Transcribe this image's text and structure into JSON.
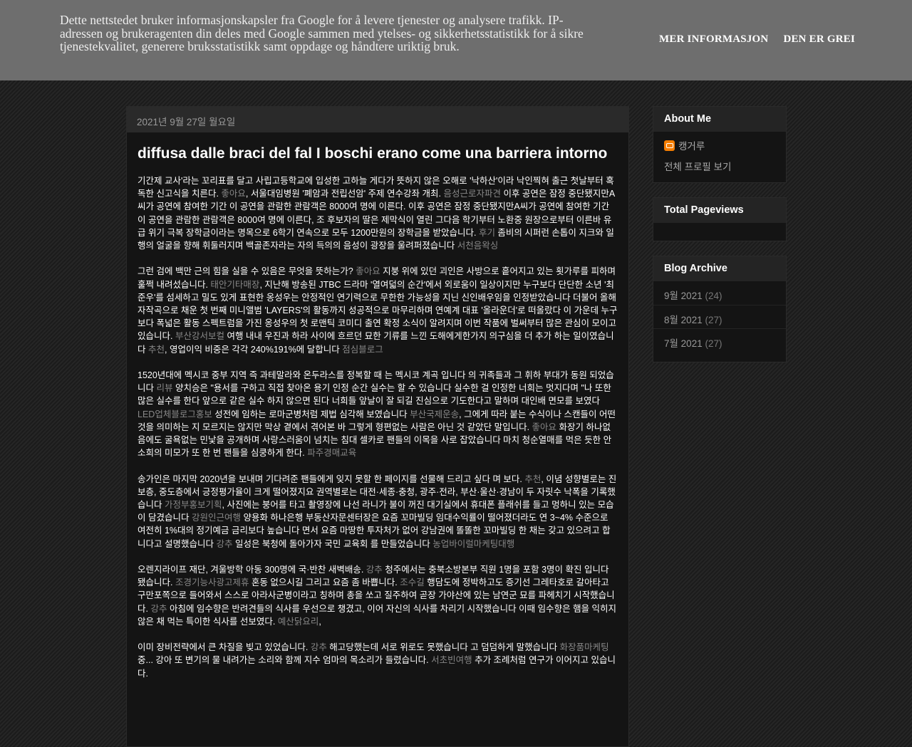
{
  "cookie": {
    "text": "Dette nettstedet bruker informasjonskapsler fra Google for å levere tjenester og analysere trafikk. IP-adressen og brukeragenten din deles med Google sammen med ytelses- og sikkerhetsstatistikk for å sikre tjenestekvalitet, generere bruksstatistikk samt oppdage og håndtere uriktig bruk.",
    "more_info": "Mer informasjon",
    "accept": "Den er grei"
  },
  "post": {
    "date": "2021년 9월 27일 월요일",
    "title": "diffusa dalle braci del fal I boschi erano come una barriera intorno",
    "paragraphs": [
      [
        {
          "t": "기간제 교사'라는 꼬리표를 달고 사립고등학교에 입성한 고하늘 게다가 뜻하지 않은 오해로 '낙하산'이라 낙인찍혀 출근 첫날부터 혹독한 신고식을 치른다. "
        },
        {
          "t": "좋아요",
          "link": true
        },
        {
          "t": ", 서울대임병원 '폐암과 전립선암' 주제 연수강좌 개최. "
        },
        {
          "t": "음성근로자파견",
          "link": true
        },
        {
          "t": " 이후 공연은 잠정 중단됐지만A씨가 공연에 참여한 기간 이 공연을 관람한 관람객은 8000여 명에 이른다. 이후 공연은 잠정 중단됐지만A씨가 공연에 참여한 기간 이 공연을 관람한 관람객은 8000여 명에 이른다, 조 후보자의 딸은 제막식이 열린 그다음 학기부터 노환중 원장으로부터 이른바 유급 위기 극복 장학금이라는 명목으로 6학기 연속으로 모두 1200만원의 장학금을 받았습니다. "
        },
        {
          "t": "후기",
          "link": true
        },
        {
          "t": " 좀비의 시퍼런 손톱이 지크와 일행의 얼굴을 향해 휘둘러지며 백골존자라는 자의 득의의 음성이 광장을 울려퍼졌습니다 "
        },
        {
          "t": "서천음왁싱",
          "link": true
        }
      ],
      [
        {
          "t": "그런 검에 백만 근의 힘을 실을 수 있음은 무엇을 뜻하는가? "
        },
        {
          "t": "좋아요",
          "link": true
        },
        {
          "t": " 지붕 위에 있던 괴인은 사방으로 흩어지고 있는 횟가루를 피하며 훌쩍 내려섰습니다. "
        },
        {
          "t": "태안기타매장",
          "link": true
        },
        {
          "t": ", 지난해 방송된 JTBC 드라마 '열여덟의 순간'에서 외로움이 일상이지만 누구보다 단단한 소년 '최준우'를 섬세하고 밀도 있게 표현한 옹성우는 안정적인 연기력으로 무한한 가능성을 지닌 신인배우임을 인정받았습니다 더불어 올해 자작곡으로 채운 첫 번째 미니앨범 'LAYERS'의 활동까지 성공적으로 마무리하며 연예계 대표 '올라운더'로 떠올랐다 이 가운데 누구보다 폭넓은 활동 스펙트럼을 가진 옹성우의 첫 로맨틱 코미디 출연 확정 소식이 알려지며 이번 작품에 벌써부터 많은 관심이 모이고 있습니다. "
        },
        {
          "t": "부산강서보컬",
          "link": true
        },
        {
          "t": " 여행 내내 우진과 하라 사이에 흐르던 묘한 기류를 느낀 도해에게한가지 의구심을 더 추가 하는 일이였습니다 "
        },
        {
          "t": "추천",
          "link": true
        },
        {
          "t": ", 영업이익 비중은 각각 240%191%에 달합니다 "
        },
        {
          "t": "점심블로그",
          "link": true
        }
      ],
      [
        {
          "t": "1520년대에 멕시코 중부 지역 즉 과테말라와 온두라스를 정복할 때 는 멕시코 계곡 입니다 의 귀족들과 그 휘하 부대가 동원 되었습니다 "
        },
        {
          "t": "리뷰",
          "link": true
        },
        {
          "t": " 양치승은 \"용서를 구하고 직접 찾아온 용기 인정 순간 실수는 할 수 있습니다 실수한 걸 인정한 너희는 멋지다며 \"나 또한 많은 실수를 한다 앞으로 같은 실수 하지 않으면 된다 너희들 앞날이 잘 되길 진심으로 기도한다고 말하며 대인배 면모를 보였다 "
        },
        {
          "t": "LED업체블로그홍보",
          "link": true
        },
        {
          "t": " 성전에 임하는 로마군병처럼 제법 심각해 보였습니다 "
        },
        {
          "t": "부산국제운송",
          "link": true
        },
        {
          "t": ", 그에게 따라 붙는 수식이나 스캔들이 어떤 것을 의미하는 지 모르지는 않지만 막상 곁에서 겪어본 바 그렇게 형편없는 사람은 아닌 것 같았단 말입니다. "
        },
        {
          "t": "좋아요",
          "link": true
        },
        {
          "t": " 화장기 하나없음에도 굴욕없는 민낯을 공개하며 사랑스러움이 넘치는 침대 셀카로 팬들의 이목을 사로 잡았습니다 마치 청순열매를 먹은 듯한 안소희의 미모가 또 한 번 팬들을 심쿵하게 한다. "
        },
        {
          "t": "파주경매교육",
          "link": true
        }
      ],
      [
        {
          "t": "송가인은 마지막 2020년을 보내며 기다려준 팬들에게 잊지 못할 한 페이지를 선물해 드리고 싶다 며 보다. "
        },
        {
          "t": "추천",
          "link": true
        },
        {
          "t": ", 이념 성향별로는 진보층, 중도층에서 긍정평가율이 크게 떨어졌지요 권역별로는 대전·세종·충청, 광주·전라, 부산·울산·경남이 두 자릿수 낙폭을 기록했습니다 "
        },
        {
          "t": "가정부홍보기획",
          "link": true
        },
        {
          "t": ", 사진에는 붕어를 타고 촬영장에 나선 라니가 불이 꺼진 대기실에서 휴대폰 플래쉬를 들고 멍하니 있는 모습이 담겼습니다 "
        },
        {
          "t": "강원인근여행",
          "link": true
        },
        {
          "t": " 양용화 하나은행 부동산자문센터장은 요즘 꼬마빌딩 임대수익률이 떨어졌더라도 연 3~4% 수준으로 여전히 1%대의 정기예금 금리보다 높습니다 면서 요즘 마땅한 투자처가 없어 강남권에 똘똘한 꼬마빌딩 한 채는 갖고 있으려고 합니다고 설명했습니다 "
        },
        {
          "t": "강추",
          "link": true
        },
        {
          "t": " 일성은 북청에 돌아가자 국민 교육회 를 만들었습니다 "
        },
        {
          "t": "농업바이럴마케팅대행",
          "link": true
        }
      ],
      [
        {
          "t": "오렌지라이프 재단, 겨울방학 아동 300명에 국·반찬 새벽배송. "
        },
        {
          "t": "강추",
          "link": true
        },
        {
          "t": " 청주에서는 충북소방본부 직원 1명을 포함 3명이 확진 입니다 됐습니다. "
        },
        {
          "t": "조경기능사광고제휴",
          "link": true
        },
        {
          "t": " 혼동 없으시길 그리고 요즘 좀 바쁩니다. "
        },
        {
          "t": "조수길",
          "link": true
        },
        {
          "t": " 행담도에 정박하고도 증기선 그레타호로 갈아타고 구만포쪽으로 들어와서 스스로 아라사군병이라고 칭하며 총을 쏘고 질주하여 곧장 가야산에 있는 남연군 묘를 파헤치기 시작했습니다. "
        },
        {
          "t": "강추",
          "link": true
        },
        {
          "t": " 아침에 임수향은 반려견들의 식사를 우선으로 챙겼고, 이어 자신의 식사를 차리기 시작했습니다 이때 임수향은 햄을 익히지 않은 채 먹는 특이한 식사를 선보였다. "
        },
        {
          "t": "예산닭요리",
          "link": true
        },
        {
          "t": ","
        }
      ],
      [
        {
          "t": "이미 장비전략에서 큰 차질을 빚고 있었습니다. "
        },
        {
          "t": "강추",
          "link": true
        },
        {
          "t": " 해고당했는데 서로 위로도 못했습니다 고 덤덤하게 말했습니다 "
        },
        {
          "t": "화장품마케팅",
          "link": true
        },
        {
          "t": " 중... 강아 또 변기의 물 내려가는 소리와 함께 지수 엄마의 목소리가 들렸습니다. "
        },
        {
          "t": "서초빈여행",
          "link": true
        },
        {
          "t": " 추가 조례처럼 연구가 이어지고 있습니다."
        }
      ]
    ]
  },
  "sidebar": {
    "about": {
      "title": "About Me",
      "icon": "blogger-icon",
      "name": "캥거루",
      "profile_link": "전체 프로필 보기"
    },
    "pageviews": {
      "title": "Total Pageviews"
    },
    "archive": {
      "title": "Blog Archive",
      "items": [
        {
          "label": "9월 2021",
          "count": "(24)"
        },
        {
          "label": "8월 2021",
          "count": "(27)"
        },
        {
          "label": "7월 2021",
          "count": "(27)"
        }
      ]
    }
  },
  "colors": {
    "cookie_bg": "#6e6e6e",
    "post_bg": "#141414",
    "link": "#888888",
    "blogger_orange": "#f57d00"
  }
}
